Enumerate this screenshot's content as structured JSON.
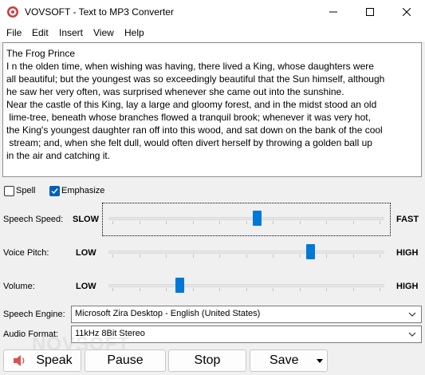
{
  "window": {
    "title": "VOVSOFT - Text to MP3 Converter",
    "minimize_icon": "minimize-icon",
    "maximize_icon": "maximize-icon",
    "close_icon": "close-icon"
  },
  "menu": [
    "File",
    "Edit",
    "Insert",
    "View",
    "Help"
  ],
  "text_content": [
    "The Frog Prince",
    "",
    "I n the olden time, when wishing was having, there lived a King, whose daughters were",
    "all beautiful; but the youngest was so exceedingly beautiful that the Sun himself, although",
    "he saw her very often, was surprised whenever she came out into the sunshine.",
    "Near the castle of this King, lay a large and gloomy forest, and in the midst stood an old",
    " lime-tree, beneath whose branches flowed a tranquil brook; whenever it was very hot,",
    "the King's youngest daughter ran off into this wood, and sat down on the bank of the cool",
    " stream; and, when she felt dull, would often divert herself by throwing a golden ball up",
    "in the air and catching it."
  ],
  "options": {
    "spell": {
      "label": "Spell",
      "checked": false
    },
    "emphasize": {
      "label": "Emphasize",
      "checked": true
    }
  },
  "sliders": {
    "speed": {
      "label": "Speech Speed:",
      "min_label": "SLOW",
      "max_label": "FAST",
      "value_fraction": 0.54
    },
    "pitch": {
      "label": "Voice Pitch:",
      "min_label": "LOW",
      "max_label": "HIGH",
      "value_fraction": 0.74
    },
    "volume": {
      "label": "Volume:",
      "min_label": "LOW",
      "max_label": "HIGH",
      "value_fraction": 0.25
    }
  },
  "engine": {
    "label": "Speech Engine:",
    "value": "Microsoft Zira Desktop - English (United States)"
  },
  "format": {
    "label": "Audio Format:",
    "value": "11kHz 8Bit Stereo"
  },
  "buttons": {
    "speak": "Speak",
    "pause": "Pause",
    "stop": "Stop",
    "save": "Save"
  },
  "watermark": "NOVSOFT",
  "colors": {
    "accent": "#0078d7",
    "check_accent": "#005fb8",
    "speaker": "#e05050"
  }
}
